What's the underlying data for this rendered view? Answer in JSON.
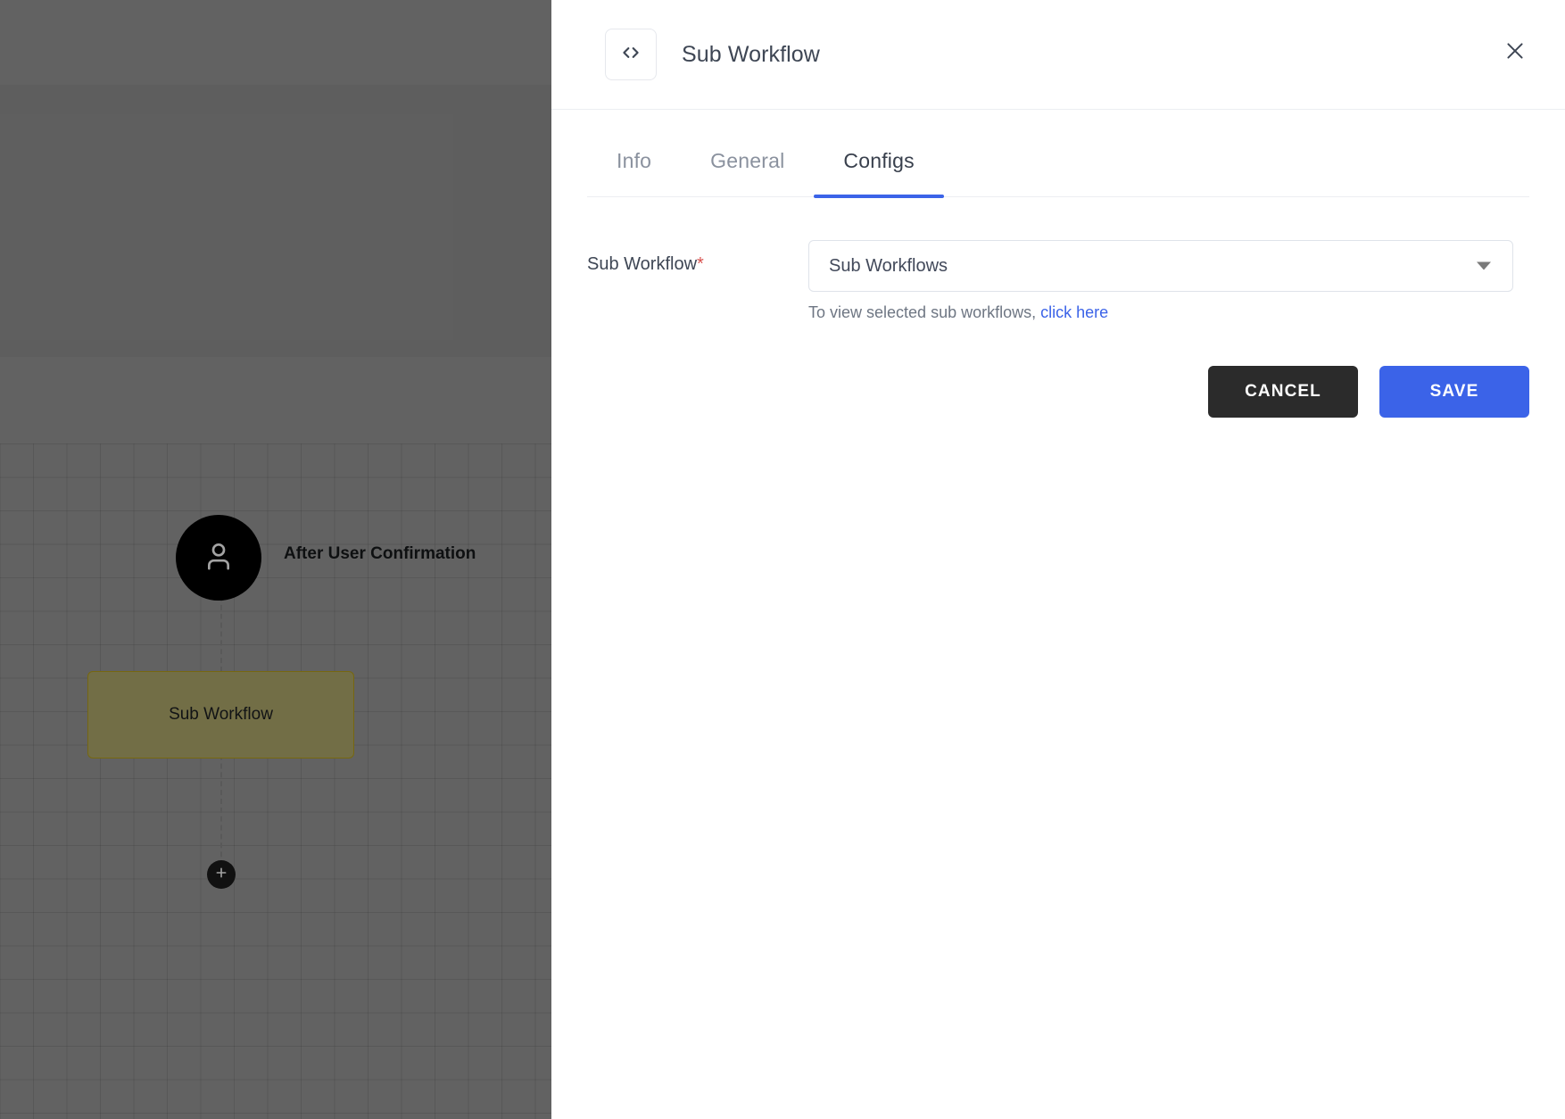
{
  "colors": {
    "accent": "#3b63e8",
    "cancel_bg": "#2b2b2b",
    "required_asterisk": "#d9534f",
    "node_border": "#b9a21a",
    "trigger_node_bg": "#000000",
    "canvas_bg": "#9a9a9a"
  },
  "canvas": {
    "trigger_node": {
      "icon": "user-icon",
      "label": "After User Confirmation"
    },
    "sub_workflow_node": {
      "label": "Sub Workflow"
    },
    "add_node_handle": {
      "icon": "plus-icon",
      "label": "+"
    }
  },
  "drawer": {
    "icon": "code-icon",
    "title": "Sub Workflow",
    "close_icon": "close-icon",
    "tabs": [
      {
        "label": "Info",
        "active": false
      },
      {
        "label": "General",
        "active": false
      },
      {
        "label": "Configs",
        "active": true
      }
    ],
    "form": {
      "field": {
        "label": "Sub Workflow",
        "required_marker": "*",
        "select_value": "Sub Workflows",
        "select_placeholder": "Sub Workflows",
        "dropdown_icon": "caret-down-icon",
        "helper_text": "To view selected sub workflows,",
        "helper_link": "click here"
      }
    },
    "actions": {
      "cancel_label": "CANCEL",
      "save_label": "SAVE"
    }
  }
}
